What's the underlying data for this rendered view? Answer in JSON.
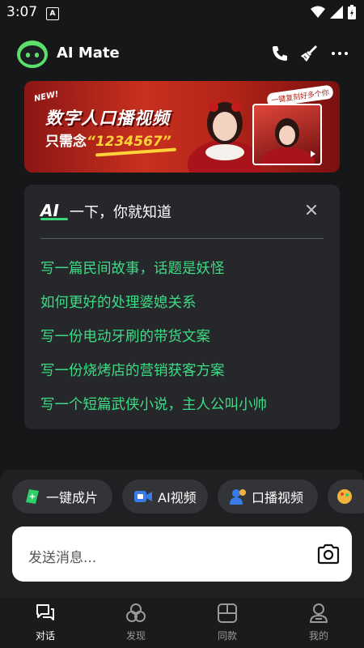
{
  "status_bar": {
    "time": "3:07",
    "app_badge": "A"
  },
  "header": {
    "title": "AI Mate",
    "phone_icon": "phone-icon",
    "clean_icon": "broom-icon",
    "more_icon": "more-icon"
  },
  "banner": {
    "new_tag": "NEW!",
    "title": "数字人口播视频",
    "subtitle_prefix": "只需念",
    "subtitle_number": "“1234567”",
    "corner_tag": "一键复刻好多个你"
  },
  "suggestions": {
    "ai_label": "AI",
    "heading": "一下，你就知道",
    "items": [
      "写一篇民间故事，话题是妖怪",
      "如何更好的处理婆媳关系",
      "写一份电动牙刷的带货文案",
      "写一份烧烤店的营销获客方案",
      "写一个短篇武侠小说，主人公叫小帅"
    ]
  },
  "quick_actions": [
    {
      "label": "一键成片",
      "icon": "film-spark-icon"
    },
    {
      "label": "AI视频",
      "icon": "video-camera-icon"
    },
    {
      "label": "口播视频",
      "icon": "presenter-icon"
    }
  ],
  "composer": {
    "placeholder": "发送消息..."
  },
  "nav": [
    {
      "label": "对话",
      "icon": "chat-icon",
      "active": true
    },
    {
      "label": "发现",
      "icon": "discover-icon",
      "active": false
    },
    {
      "label": "同款",
      "icon": "template-icon",
      "active": false
    },
    {
      "label": "我的",
      "icon": "profile-icon",
      "active": false
    }
  ],
  "colors": {
    "accent_green": "#3ddc84",
    "background": "#161718",
    "card": "#25272a"
  }
}
